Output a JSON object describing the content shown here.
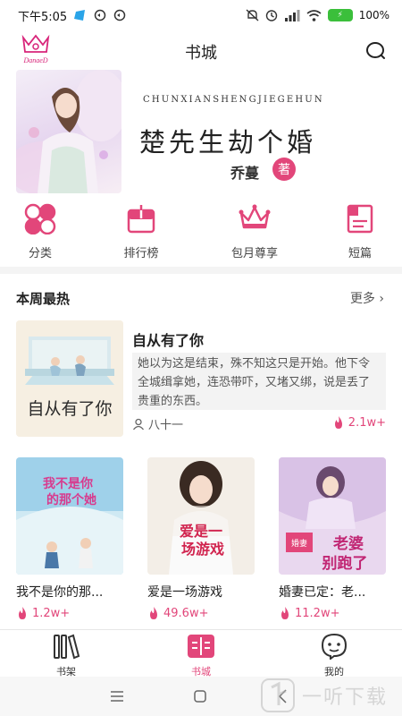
{
  "status_bar": {
    "time": "下午5:05",
    "battery": "100%"
  },
  "header": {
    "title": "书城",
    "logo_text": "DanaeD"
  },
  "banner": {
    "pinyin": "CHUNXIANSHENGJIEGEHUN",
    "title": "楚先生劫个婚",
    "author": "乔蔓",
    "author_suffix": "著"
  },
  "quick_nav": [
    {
      "label": "分类",
      "icon": "category-icon"
    },
    {
      "label": "排行榜",
      "icon": "ranking-icon"
    },
    {
      "label": "包月尊享",
      "icon": "crown-icon"
    },
    {
      "label": "短篇",
      "icon": "short-story-icon"
    }
  ],
  "section": {
    "title": "本周最热",
    "more": "更多"
  },
  "featured": {
    "title": "自从有了你",
    "cover_text": "自从有了你",
    "description": "她以为这是结束，殊不知这只是开始。他下令全城缉拿她，连恐带吓，又堵又绑，说是丢了贵重的东西。",
    "author": "八十一",
    "heat": "2.1w+"
  },
  "books": [
    {
      "title": "我不是你的那...",
      "heat": "1.2w+",
      "cover_text": "我不是你的那个她"
    },
    {
      "title": "爱是一场游戏",
      "heat": "49.6w+",
      "cover_text": "爱是一场游戏"
    },
    {
      "title": "婚妻已定：老...",
      "heat": "11.2w+",
      "cover_text": "婚妻已定 老婆别跑了"
    }
  ],
  "bottom_nav": [
    {
      "label": "书架",
      "icon": "bookshelf-icon",
      "active": false
    },
    {
      "label": "书城",
      "icon": "bookstore-icon",
      "active": true
    },
    {
      "label": "我的",
      "icon": "profile-icon",
      "active": false
    }
  ],
  "watermark": {
    "text": "一听下载"
  },
  "colors": {
    "accent": "#e2467a",
    "text": "#222222",
    "muted": "#555555"
  }
}
